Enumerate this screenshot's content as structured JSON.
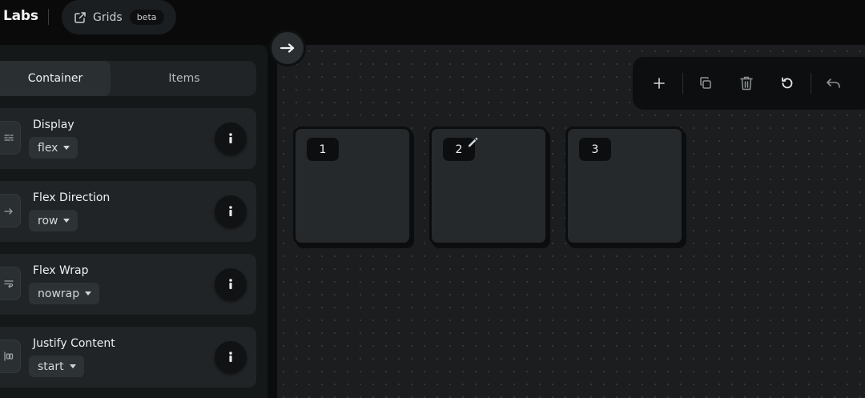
{
  "header": {
    "brand": "Labs",
    "nav_label": "Grids",
    "badge": "beta"
  },
  "sidebar": {
    "tabs": [
      {
        "label": "Container",
        "active": true
      },
      {
        "label": "Items",
        "active": false
      }
    ],
    "properties": [
      {
        "title": "Display",
        "value": "flex",
        "icon": "display-icon"
      },
      {
        "title": "Flex Direction",
        "value": "row",
        "icon": "arrow-right-icon"
      },
      {
        "title": "Flex Wrap",
        "value": "nowrap",
        "icon": "wrap-icon"
      },
      {
        "title": "Justify Content",
        "value": "start",
        "icon": "justify-icon"
      }
    ]
  },
  "canvas": {
    "items": [
      {
        "label": "1"
      },
      {
        "label": "2"
      },
      {
        "label": "3"
      }
    ]
  },
  "toolbar": {
    "actions": [
      "add-icon",
      "duplicate-icon",
      "delete-icon",
      "reset-icon",
      "undo-icon"
    ]
  },
  "colors": {
    "background": "#0b0c0d",
    "panel": "#151819",
    "card": "#202426",
    "canvas": "#1b1d1f",
    "item": "#25292c"
  }
}
